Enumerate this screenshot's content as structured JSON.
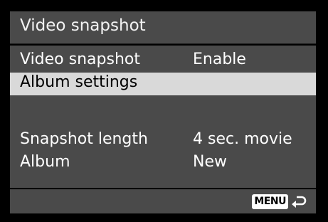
{
  "header": {
    "title": "Video snapshot"
  },
  "menu": {
    "items": [
      {
        "label": "Video snapshot",
        "value": "Enable",
        "selected": false
      },
      {
        "label": "Album settings",
        "value": "",
        "selected": true
      },
      {
        "label": "Snapshot length",
        "value": "4 sec. movie",
        "selected": false
      },
      {
        "label": "Album",
        "value": "New",
        "selected": false
      }
    ]
  },
  "footer": {
    "menu_button_label": "MENU",
    "return_icon": "return-arrow-icon"
  },
  "colors": {
    "background": "#000000",
    "panel": "#4a4a4a",
    "selection_highlight": "#d9d9d9",
    "text": "#ffffff"
  }
}
